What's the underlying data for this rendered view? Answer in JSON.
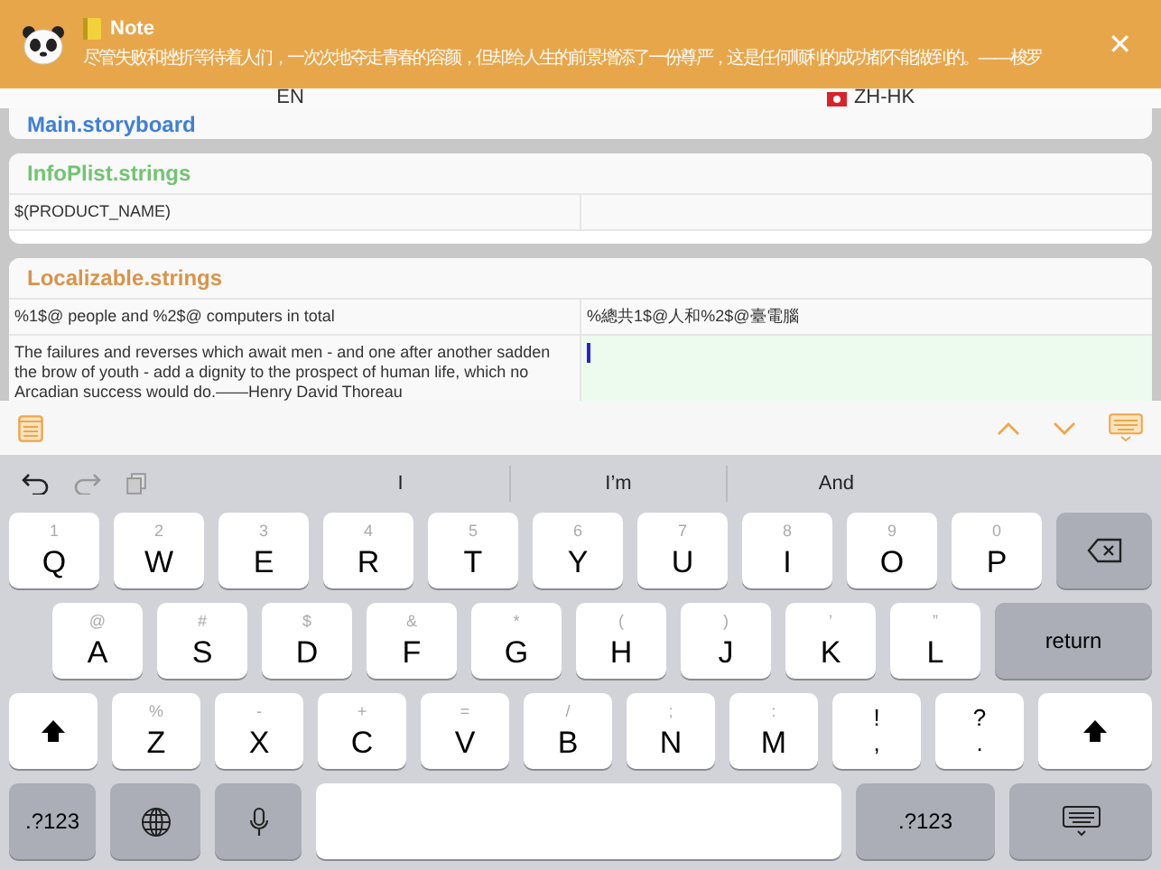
{
  "banner": {
    "title": "Note",
    "message": "尽管失败和挫折等待着人们，一次次地夺走青春的容颜，但却给人生的前景增添了一份尊严，这是任何顺利的成功都不能做到的。——梭罗",
    "close": "✕"
  },
  "languages": [
    "EN",
    "ZH-HK"
  ],
  "sections": [
    {
      "title": "Main.storyboard",
      "color": "#3f7fd9"
    },
    {
      "title": "InfoPlist.strings",
      "color": "#72c472",
      "rows": [
        {
          "source": "$(PRODUCT_NAME)",
          "editing": false
        }
      ]
    },
    {
      "title": "Localizable.strings",
      "color": "#d9944a",
      "rows": [
        {
          "source": "%1$@ people and %2$@ computers in total",
          "translation": "%總共1$@人和%2$@臺電腦",
          "editing": false
        },
        {
          "source": "The failures and reverses which await men - and one after another sadden the brow of youth - add a dignity to the prospect of human life, which no Arcadian success would do.——Henry David Thoreau",
          "editing": true
        }
      ]
    }
  ],
  "suggestions": [
    "I",
    "I’m",
    "And"
  ],
  "keyboard": [
    [
      {
        "kind": "letter",
        "main": "Q",
        "alt": "1"
      },
      {
        "kind": "letter",
        "main": "W",
        "alt": "2"
      },
      {
        "kind": "letter",
        "main": "E",
        "alt": "3"
      },
      {
        "kind": "letter",
        "main": "R",
        "alt": "4"
      },
      {
        "kind": "letter",
        "main": "T",
        "alt": "5"
      },
      {
        "kind": "letter",
        "main": "Y",
        "alt": "6"
      },
      {
        "kind": "letter",
        "main": "U",
        "alt": "7"
      },
      {
        "kind": "letter",
        "main": "I",
        "alt": "8"
      },
      {
        "kind": "letter",
        "main": "O",
        "alt": "9"
      },
      {
        "kind": "letter",
        "main": "P",
        "alt": "0"
      },
      {
        "kind": "backspace"
      }
    ],
    [
      {
        "kind": "letter",
        "main": "A",
        "alt": "@"
      },
      {
        "kind": "letter",
        "main": "S",
        "alt": "#"
      },
      {
        "kind": "letter",
        "main": "D",
        "alt": "$"
      },
      {
        "kind": "letter",
        "main": "F",
        "alt": "&"
      },
      {
        "kind": "letter",
        "main": "G",
        "alt": "*"
      },
      {
        "kind": "letter",
        "main": "H",
        "alt": "("
      },
      {
        "kind": "letter",
        "main": "J",
        "alt": ")"
      },
      {
        "kind": "letter",
        "main": "K",
        "alt": "’"
      },
      {
        "kind": "letter",
        "main": "L",
        "alt": "”"
      },
      {
        "kind": "return",
        "label": "return"
      }
    ],
    [
      {
        "kind": "shift"
      },
      {
        "kind": "letter",
        "main": "Z",
        "alt": "%"
      },
      {
        "kind": "letter",
        "main": "X",
        "alt": "-"
      },
      {
        "kind": "letter",
        "main": "C",
        "alt": "+"
      },
      {
        "kind": "letter",
        "main": "V",
        "alt": "="
      },
      {
        "kind": "letter",
        "main": "B",
        "alt": "/"
      },
      {
        "kind": "letter",
        "main": "N",
        "alt": ";"
      },
      {
        "kind": "letter",
        "main": "M",
        "alt": ":"
      },
      {
        "kind": "punct",
        "main": ",",
        "alt": "!"
      },
      {
        "kind": "punct",
        "main": ".",
        "alt": "?"
      },
      {
        "kind": "shift"
      }
    ],
    [
      {
        "kind": "mode",
        "label": ".?123"
      },
      {
        "kind": "globe"
      },
      {
        "kind": "mic"
      },
      {
        "kind": "space"
      },
      {
        "kind": "mode",
        "label": ".?123"
      },
      {
        "kind": "hide"
      }
    ]
  ]
}
